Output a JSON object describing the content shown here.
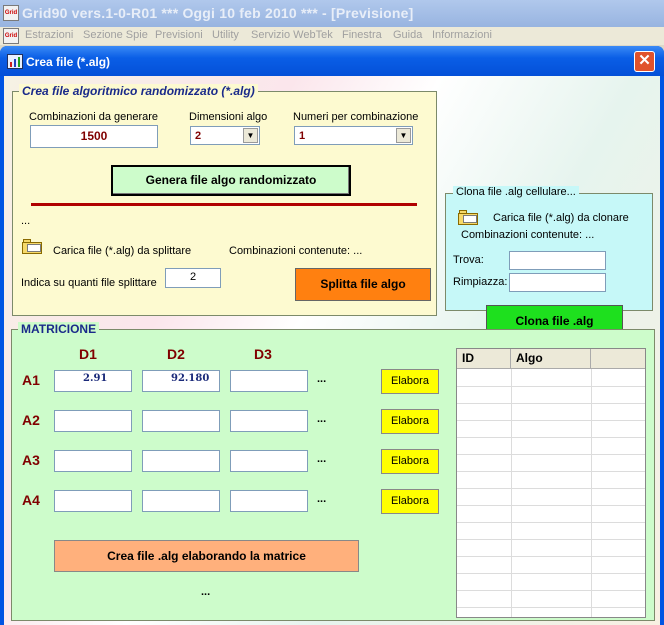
{
  "app": {
    "title": "Grid90 vers.1-0-R01  ***  Oggi 10 feb 2010  ***   - [Previsione]",
    "icon_text": "Grid",
    "menu": [
      "Estrazioni",
      "Sezione Spie",
      "Previsioni",
      "Utility",
      "Servizio WebTek",
      "Finestra",
      "Guida",
      "Informazioni"
    ]
  },
  "dialog": {
    "title": "Crea file (*.alg)",
    "close_glyph": "✕"
  },
  "random_panel": {
    "legend": "Crea file algoritmico randomizzato (*.alg)",
    "combinations_label": "Combinazioni da generare",
    "combinations_value": "1500",
    "dimension_label": "Dimensioni algo",
    "dimension_value": "2",
    "numbers_label": "Numeri per combinazione",
    "numbers_value": "1",
    "generate_button": "Genera file algo randomizzato",
    "status_dots": "...",
    "load_split_label": "Carica file (*.alg) da splittare",
    "contained_label": "Combinazioni contenute: ...",
    "split_count_label": "Indica su quanti file splittare",
    "split_count_value": "2",
    "split_button": "Splitta file algo"
  },
  "clone_panel": {
    "legend": "Clona file .alg cellulare...",
    "load_label": "Carica file (*.alg) da clonare",
    "contained_label": "Combinazioni contenute: ...",
    "find_label": "Trova:",
    "replace_label": "Rimpiazza:",
    "clone_button": "Clona file .alg"
  },
  "matrix_panel": {
    "legend": "MATRICIONE",
    "columns": [
      "D1",
      "D2",
      "D3"
    ],
    "rows": [
      {
        "label": "A1",
        "values": [
          "2.91",
          "92.180",
          ""
        ],
        "more": "...",
        "button": "Elabora"
      },
      {
        "label": "A2",
        "values": [
          "",
          "",
          ""
        ],
        "more": "...",
        "button": "Elabora"
      },
      {
        "label": "A3",
        "values": [
          "",
          "",
          ""
        ],
        "more": "...",
        "button": "Elabora"
      },
      {
        "label": "A4",
        "values": [
          "",
          "",
          ""
        ],
        "more": "...",
        "button": "Elabora"
      }
    ],
    "create_button": "Crea file .alg elaborando la matrice",
    "bottom_dots": "...",
    "grid_headers": [
      "ID",
      "Algo",
      ""
    ]
  },
  "colors": {
    "random_panel_bg": "#fdfad0",
    "clone_panel_bg": "#c6f8f8",
    "matrix_panel_bg": "#cdfccb",
    "generate_button_bg": "#cdfccb",
    "split_button_bg": "#ff8010",
    "clone_button_bg": "#1ee01e",
    "elabora_button_bg": "#ffff00",
    "create_button_bg": "#ffb07c",
    "label_red": "#800000",
    "divider_red": "#b00000"
  }
}
